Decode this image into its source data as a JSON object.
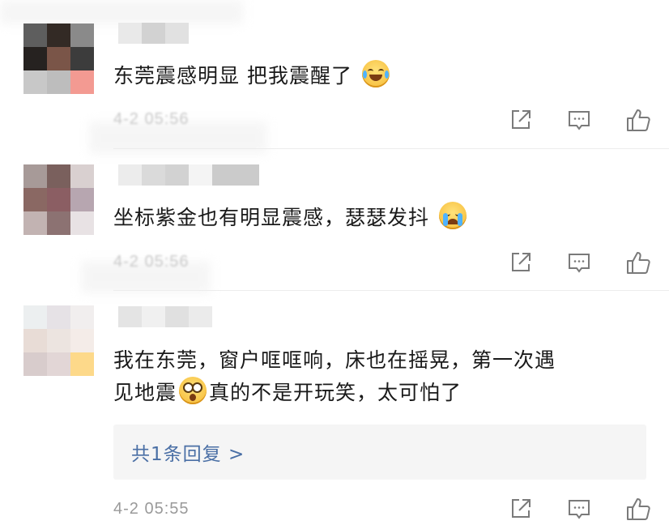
{
  "colors": {
    "text": "#1a1a1a",
    "timestamp": "#9a9a9a",
    "reply_link": "#4a6fa5",
    "icon": "#7a7a7a",
    "reply_box_bg": "#f5f5f5"
  },
  "comments": [
    {
      "text_before": "东莞震感明显 把我震醒了",
      "emoji": "laugh-cry-emoji",
      "time": "4-2 05:56"
    },
    {
      "text_before": "坐标紫金也有明显震感，瑟瑟发抖",
      "emoji": "crying-emoji",
      "time": "4-2 05:56"
    },
    {
      "text_line1": "我在东莞，窗户哐哐响，床也在摇晃，第一次遇",
      "text_line2_a": "见地震",
      "emoji": "shocked-emoji",
      "text_line2_b": "真的不是开玩笑，太可怕了",
      "reply_label": "共1条回复 >",
      "time": "4-2 05:55"
    }
  ],
  "icons": [
    "share-icon",
    "comment-icon",
    "like-icon"
  ]
}
